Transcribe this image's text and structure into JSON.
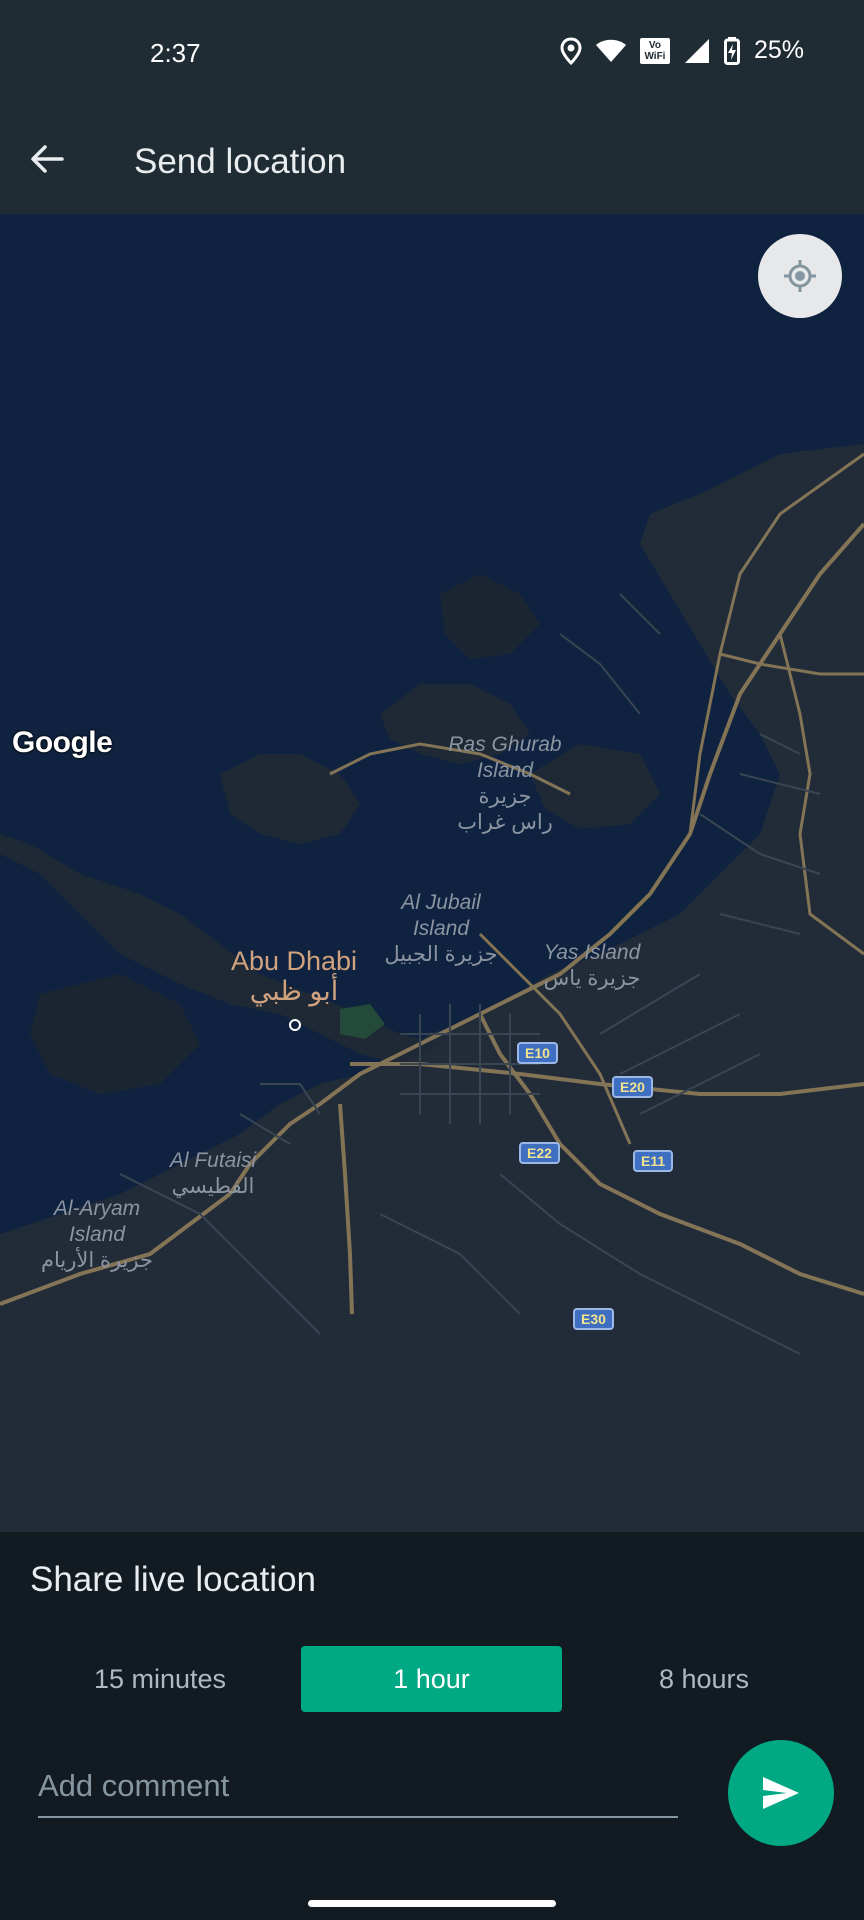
{
  "status_bar": {
    "time": "2:37",
    "vowifi_line1": "Vo",
    "vowifi_line2": "WiFi",
    "battery": "25%",
    "icons": [
      "location-icon",
      "wifi-icon",
      "vowifi-icon",
      "signal-icon",
      "battery-charging-icon"
    ]
  },
  "app_bar": {
    "title": "Send location",
    "back_icon": "arrow-left-icon"
  },
  "map": {
    "provider_logo": "Google",
    "labels": {
      "ras_ghurab_en": "Ras Ghurab\nIsland",
      "ras_ghurab_ar": "جزيرة\nراس غراب",
      "al_jubail_en": "Al Jubail\nIsland",
      "al_jubail_ar": "جزيرة الجبيل",
      "yas_en": "Yas Island",
      "yas_ar": "جزيرة ياس",
      "abu_dhabi_en": "Abu Dhabi",
      "abu_dhabi_ar": "أبو ظبي",
      "al_futaisi_en": "Al Futaisi",
      "al_futaisi_ar": "الفطيسي",
      "al_aryam_en": "Al-Aryam\nIsland",
      "al_aryam_ar": "جزيرة الأريام"
    },
    "road_shields": {
      "e10": "E10",
      "e20": "E20",
      "e22": "E22",
      "e11": "E11",
      "e30": "E30"
    },
    "locate_icon": "my-location-icon"
  },
  "share": {
    "title": "Share live location",
    "durations": [
      {
        "label": "15 minutes",
        "selected": false
      },
      {
        "label": "1 hour",
        "selected": true
      },
      {
        "label": "8 hours",
        "selected": false
      }
    ],
    "comment_placeholder": "Add comment",
    "comment_value": "",
    "send_icon": "send-icon"
  },
  "colors": {
    "accent": "#00a884",
    "toolbar": "#202c33",
    "sheet": "#111b21",
    "map_water": "#0f2340"
  }
}
